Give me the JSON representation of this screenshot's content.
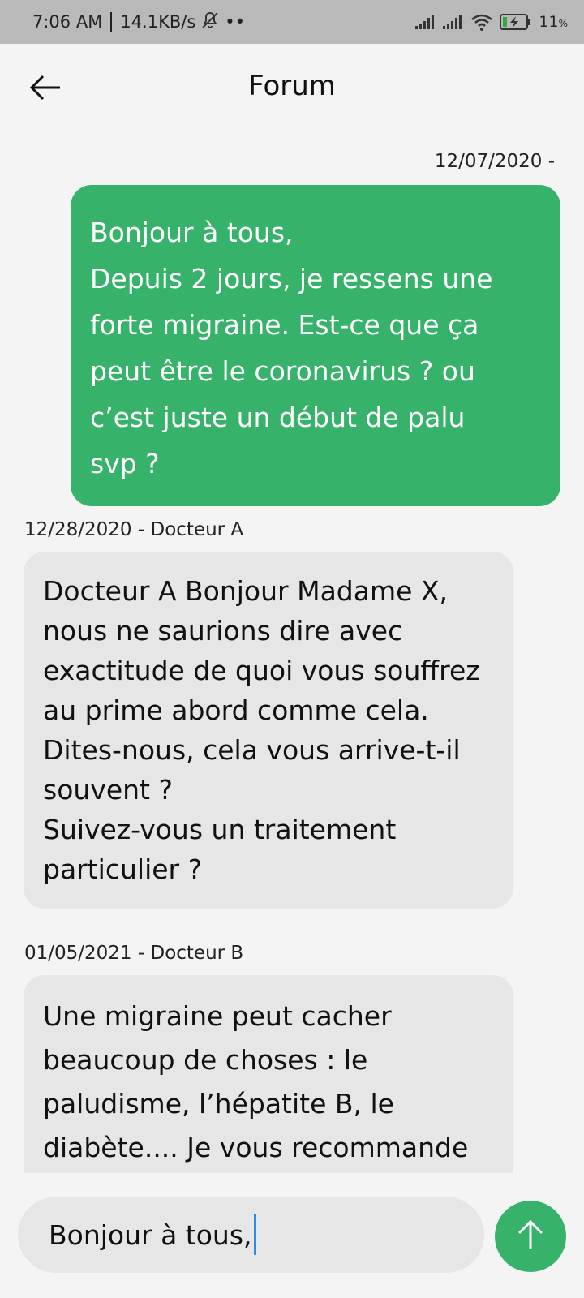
{
  "status_bar": {
    "time": "7:06 AM",
    "speed": "14.1KB/s",
    "dots": "••",
    "battery_percent": "11",
    "battery_unit": "%",
    "icons": [
      "mute-icon",
      "signal-icon",
      "signal-icon",
      "wifi-icon",
      "battery-charging-icon"
    ]
  },
  "header": {
    "title": "Forum",
    "back_icon": "arrow-left-icon"
  },
  "messages": [
    {
      "type": "sent",
      "meta": "12/07/2020 -",
      "lines": [
        "Bonjour à tous,",
        "Depuis 2 jours, je ressens une",
        "forte migraine. Est-ce que ça",
        "peut être le coronavirus ? ou",
        "c’est juste un début de palu",
        "svp ?"
      ]
    },
    {
      "type": "received",
      "meta": "12/28/2020 - Docteur A",
      "lines": [
        "Docteur A Bonjour Madame X,",
        "nous ne saurions dire avec",
        "exactitude de quoi vous souffrez",
        "au prime abord comme cela.",
        "Dites-nous, cela vous arrive-t-il",
        "souvent ?",
        "Suivez-vous un traitement",
        "particulier ?"
      ]
    },
    {
      "type": "received",
      "meta": "01/05/2021 - Docteur B",
      "lines": [
        "Une migraine peut cacher",
        "beaucoup de choses : le",
        "paludisme, l’hépatite B, le",
        "diabète.... Je vous recommande"
      ]
    }
  ],
  "composer": {
    "value": "Bonjour à tous,",
    "send_icon": "arrow-up-icon"
  },
  "colors": {
    "accent": "#36b26a",
    "received_bubble": "#e6e6e6",
    "background": "#f4f4f4",
    "status_bar": "#b9b9b9",
    "caret": "#2f8ae6"
  }
}
